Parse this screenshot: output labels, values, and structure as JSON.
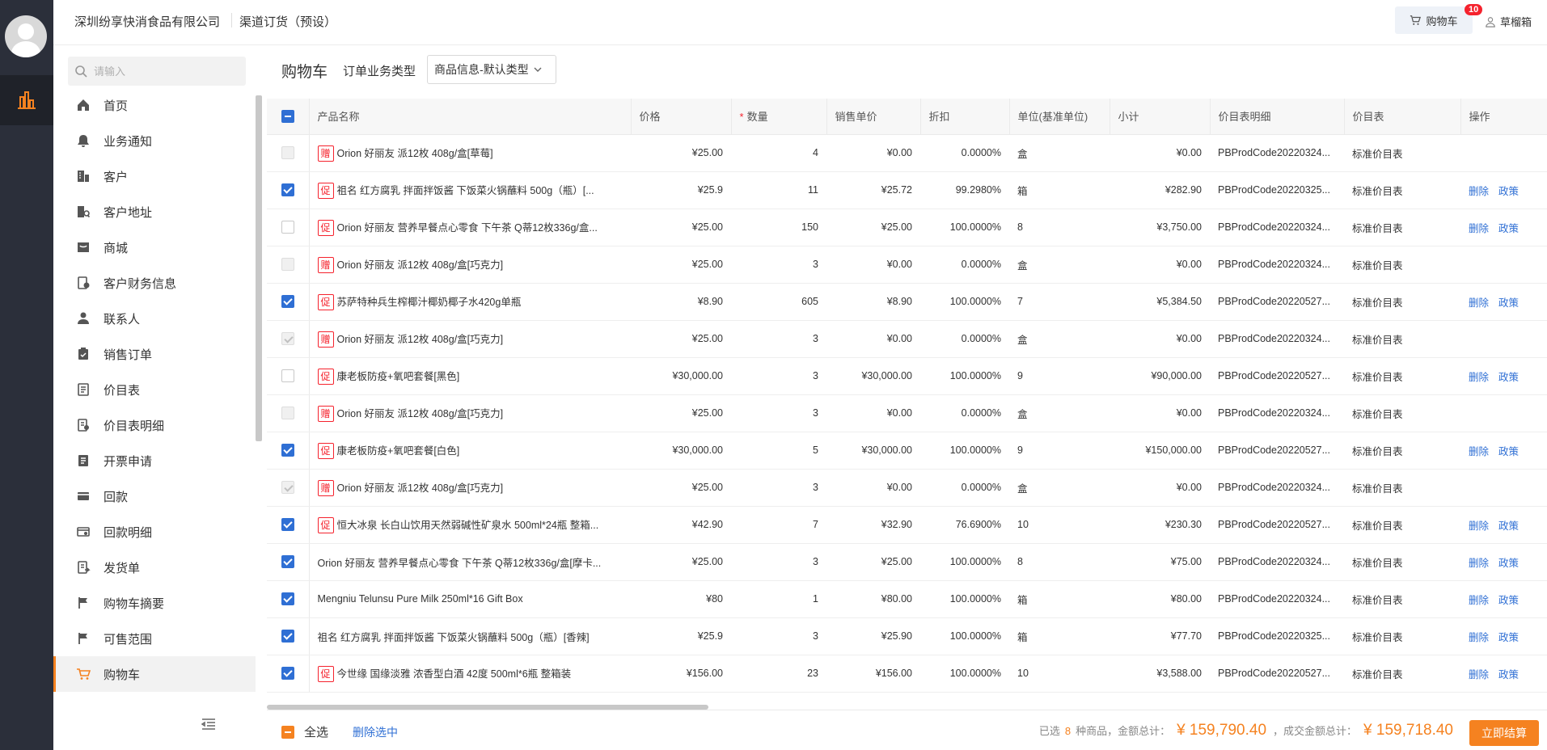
{
  "header": {
    "company": "深圳纷享快消食品有限公司",
    "channel": "渠道订货（预设）",
    "cart_label": "购物车",
    "cart_badge": "10",
    "user_name": "草榴箱"
  },
  "sidebar": {
    "search_placeholder": "请输入",
    "items": [
      {
        "label": "首页",
        "icon": "home-icon"
      },
      {
        "label": "业务通知",
        "icon": "bell-icon"
      },
      {
        "label": "客户",
        "icon": "building-icon"
      },
      {
        "label": "客户地址",
        "icon": "address-icon"
      },
      {
        "label": "商城",
        "icon": "store-icon"
      },
      {
        "label": "客户财务信息",
        "icon": "finance-icon"
      },
      {
        "label": "联系人",
        "icon": "person-icon"
      },
      {
        "label": "销售订单",
        "icon": "clipboard-icon"
      },
      {
        "label": "价目表",
        "icon": "doc-icon"
      },
      {
        "label": "价目表明细",
        "icon": "doc-detail-icon"
      },
      {
        "label": "开票申请",
        "icon": "invoice-icon"
      },
      {
        "label": "回款",
        "icon": "card-icon"
      },
      {
        "label": "回款明细",
        "icon": "card-detail-icon"
      },
      {
        "label": "发货单",
        "icon": "delivery-icon"
      },
      {
        "label": "购物车摘要",
        "icon": "flag-icon"
      },
      {
        "label": "可售范围",
        "icon": "flag-icon"
      },
      {
        "label": "购物车",
        "icon": "cart-icon",
        "active": true
      }
    ]
  },
  "main": {
    "title": "购物车",
    "type_label": "订单业务类型",
    "type_value": "商品信息-默认类型",
    "columns": [
      "产品名称",
      "价格",
      "数量",
      "销售单价",
      "折扣",
      "单位(基准单位)",
      "小计",
      "价目表明细",
      "价目表",
      "操作"
    ],
    "rows": [
      {
        "check": "dis",
        "tag": "赠",
        "name": "Orion 好丽友 派12枚 408g/盒[草莓]",
        "price": "¥25.00",
        "qty": "4",
        "unit_price": "¥0.00",
        "discount": "0.0000%",
        "unit": "盒",
        "subtotal": "¥0.00",
        "detail": "PBProdCode20220324...",
        "pricebook": "标准价目表",
        "del": "",
        "policy": ""
      },
      {
        "check": "on",
        "tag": "促",
        "name": "祖名 红方腐乳 拌面拌饭酱 下饭菜火锅蘸料 500g（瓶）[...",
        "price": "¥25.9",
        "qty": "11",
        "unit_price": "¥25.72",
        "discount": "99.2980%",
        "unit": "箱",
        "subtotal": "¥282.90",
        "detail": "PBProdCode20220325...",
        "pricebook": "标准价目表",
        "del": "删除",
        "policy": "政策"
      },
      {
        "check": "off",
        "tag": "促",
        "name": "Orion 好丽友 营养早餐点心零食 下午茶 Q蒂12枚336g/盒...",
        "price": "¥25.00",
        "qty": "150",
        "unit_price": "¥25.00",
        "discount": "100.0000%",
        "unit": "8",
        "subtotal": "¥3,750.00",
        "detail": "PBProdCode20220324...",
        "pricebook": "标准价目表",
        "del": "删除",
        "policy": "政策"
      },
      {
        "check": "dis",
        "tag": "赠",
        "name": "Orion 好丽友 派12枚 408g/盒[巧克力]",
        "price": "¥25.00",
        "qty": "3",
        "unit_price": "¥0.00",
        "discount": "0.0000%",
        "unit": "盒",
        "subtotal": "¥0.00",
        "detail": "PBProdCode20220324...",
        "pricebook": "标准价目表",
        "del": "",
        "policy": ""
      },
      {
        "check": "on",
        "tag": "促",
        "name": "苏萨特种兵生榨椰汁椰奶椰子水420g单瓶",
        "price": "¥8.90",
        "qty": "605",
        "unit_price": "¥8.90",
        "discount": "100.0000%",
        "unit": "7",
        "subtotal": "¥5,384.50",
        "detail": "PBProdCode20220527...",
        "pricebook": "标准价目表",
        "del": "删除",
        "policy": "政策"
      },
      {
        "check": "dis-on",
        "tag": "赠",
        "name": "Orion 好丽友 派12枚 408g/盒[巧克力]",
        "price": "¥25.00",
        "qty": "3",
        "unit_price": "¥0.00",
        "discount": "0.0000%",
        "unit": "盒",
        "subtotal": "¥0.00",
        "detail": "PBProdCode20220324...",
        "pricebook": "标准价目表",
        "del": "",
        "policy": ""
      },
      {
        "check": "off",
        "tag": "促",
        "name": "康老板防疫+氧吧套餐[黑色]",
        "price": "¥30,000.00",
        "qty": "3",
        "unit_price": "¥30,000.00",
        "discount": "100.0000%",
        "unit": "9",
        "subtotal": "¥90,000.00",
        "detail": "PBProdCode20220527...",
        "pricebook": "标准价目表",
        "del": "删除",
        "policy": "政策"
      },
      {
        "check": "dis",
        "tag": "赠",
        "name": "Orion 好丽友 派12枚 408g/盒[巧克力]",
        "price": "¥25.00",
        "qty": "3",
        "unit_price": "¥0.00",
        "discount": "0.0000%",
        "unit": "盒",
        "subtotal": "¥0.00",
        "detail": "PBProdCode20220324...",
        "pricebook": "标准价目表",
        "del": "",
        "policy": ""
      },
      {
        "check": "on",
        "tag": "促",
        "name": "康老板防疫+氧吧套餐[白色]",
        "price": "¥30,000.00",
        "qty": "5",
        "unit_price": "¥30,000.00",
        "discount": "100.0000%",
        "unit": "9",
        "subtotal": "¥150,000.00",
        "detail": "PBProdCode20220527...",
        "pricebook": "标准价目表",
        "del": "删除",
        "policy": "政策"
      },
      {
        "check": "dis-on",
        "tag": "赠",
        "name": "Orion 好丽友 派12枚 408g/盒[巧克力]",
        "price": "¥25.00",
        "qty": "3",
        "unit_price": "¥0.00",
        "discount": "0.0000%",
        "unit": "盒",
        "subtotal": "¥0.00",
        "detail": "PBProdCode20220324...",
        "pricebook": "标准价目表",
        "del": "",
        "policy": ""
      },
      {
        "check": "on",
        "tag": "促",
        "name": "恒大冰泉 长白山饮用天然弱碱性矿泉水 500ml*24瓶 整箱...",
        "price": "¥42.90",
        "qty": "7",
        "unit_price": "¥32.90",
        "discount": "76.6900%",
        "unit": "10",
        "subtotal": "¥230.30",
        "detail": "PBProdCode20220527...",
        "pricebook": "标准价目表",
        "del": "删除",
        "policy": "政策"
      },
      {
        "check": "on",
        "tag": "",
        "name": "Orion 好丽友 营养早餐点心零食 下午茶 Q蒂12枚336g/盒[摩卡...",
        "price": "¥25.00",
        "qty": "3",
        "unit_price": "¥25.00",
        "discount": "100.0000%",
        "unit": "8",
        "subtotal": "¥75.00",
        "detail": "PBProdCode20220324...",
        "pricebook": "标准价目表",
        "del": "删除",
        "policy": "政策"
      },
      {
        "check": "on",
        "tag": "",
        "name": "Mengniu Telunsu Pure Milk 250ml*16 Gift Box",
        "price": "¥80",
        "qty": "1",
        "unit_price": "¥80.00",
        "discount": "100.0000%",
        "unit": "箱",
        "subtotal": "¥80.00",
        "detail": "PBProdCode20220324...",
        "pricebook": "标准价目表",
        "del": "删除",
        "policy": "政策"
      },
      {
        "check": "on",
        "tag": "",
        "name": "祖名 红方腐乳 拌面拌饭酱 下饭菜火锅蘸料 500g（瓶）[香辣]",
        "price": "¥25.9",
        "qty": "3",
        "unit_price": "¥25.90",
        "discount": "100.0000%",
        "unit": "箱",
        "subtotal": "¥77.70",
        "detail": "PBProdCode20220325...",
        "pricebook": "标准价目表",
        "del": "删除",
        "policy": "政策"
      },
      {
        "check": "on",
        "tag": "促",
        "name": "今世缘 国缘淡雅 浓香型白酒 42度 500ml*6瓶 整箱装",
        "price": "¥156.00",
        "qty": "23",
        "unit_price": "¥156.00",
        "discount": "100.0000%",
        "unit": "10",
        "subtotal": "¥3,588.00",
        "detail": "PBProdCode20220527...",
        "pricebook": "标准价目表",
        "del": "删除",
        "policy": "政策"
      }
    ]
  },
  "footer": {
    "select_all": "全选",
    "delete_selected": "删除选中",
    "selected_prefix": "已选",
    "selected_count": "8",
    "selected_suffix": "种商品，金额总计：",
    "total_amount": "¥ 159,790.40",
    "deal_label": "，成交金额总计：",
    "deal_amount": "¥ 159,718.40",
    "checkout": "立即结算"
  },
  "colors": {
    "accent": "#f58220",
    "link": "#2f6fd4",
    "tag": "#f5222d",
    "rail": "#2b2f3a"
  }
}
